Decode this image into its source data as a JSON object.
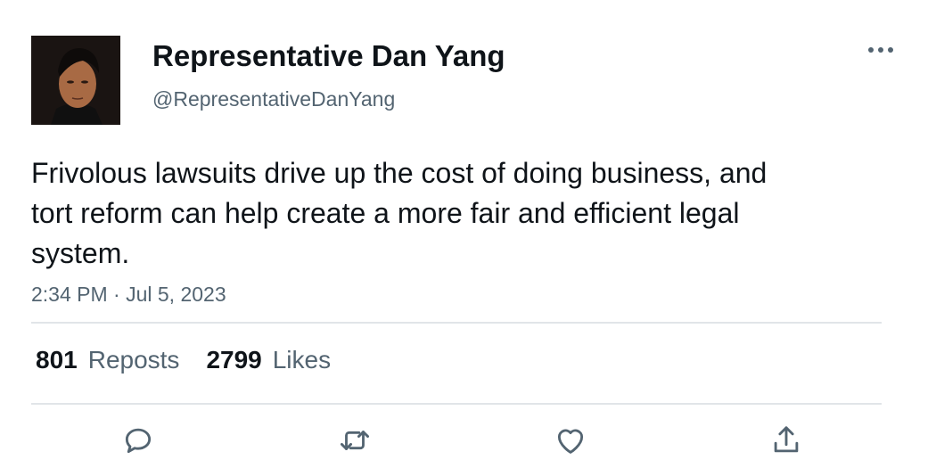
{
  "user": {
    "display_name": "Representative Dan Yang",
    "handle": "@RepresentativeDanYang",
    "avatar_icon": "profile-photo"
  },
  "tweet": {
    "text": "Frivolous lawsuits drive up the cost of doing business, and tort reform can help create a more fair and efficient legal system.",
    "timestamp": "2:34 PM · Jul 5, 2023"
  },
  "stats": {
    "reposts_count": "801",
    "reposts_label": "Reposts",
    "likes_count": "2799",
    "likes_label": "Likes"
  },
  "actions": {
    "reply_icon": "speech-bubble-icon",
    "repost_icon": "retweet-arrows-icon",
    "like_icon": "heart-icon",
    "share_icon": "share-upload-icon",
    "more_icon": "more-dots-icon"
  },
  "colors": {
    "text_primary": "#0f1419",
    "text_secondary": "#536471",
    "divider": "#e1e5e8"
  }
}
